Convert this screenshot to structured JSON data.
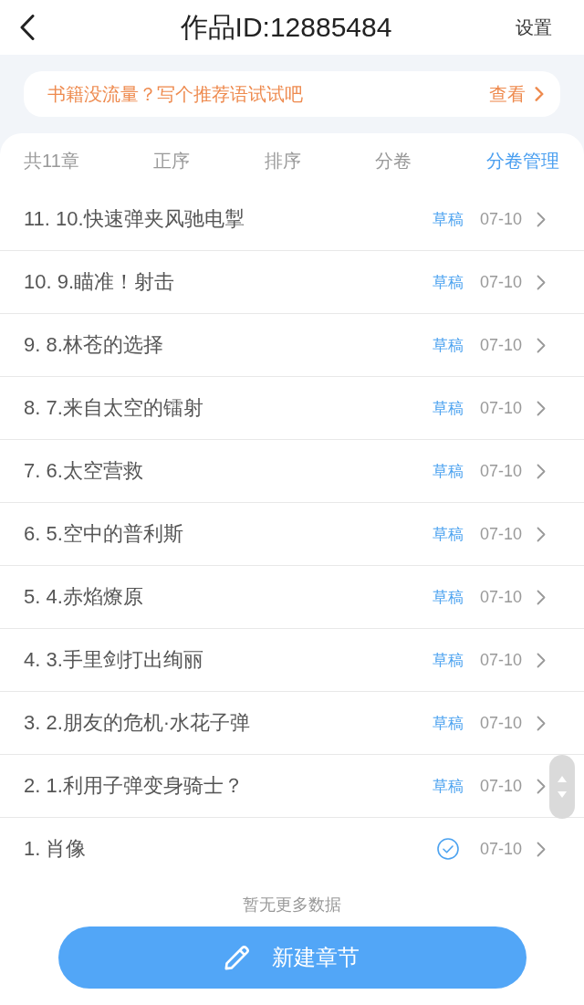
{
  "header": {
    "title": "作品ID:12885484",
    "action": "设置"
  },
  "banner": {
    "text": "书籍没流量？写个推荐语试试吧",
    "link": "查看"
  },
  "toolbar": {
    "count": "共11章",
    "actions": [
      {
        "label": "正序",
        "selected": false
      },
      {
        "label": "排序",
        "selected": false
      },
      {
        "label": "分卷",
        "selected": false
      },
      {
        "label": "分卷管理",
        "selected": true
      }
    ]
  },
  "chapters": [
    {
      "title": "11. 10.快速弹夹风驰电掣",
      "status": {
        "kind": "draft",
        "label": "草稿"
      },
      "date": "07-10"
    },
    {
      "title": "10. 9.瞄准！射击",
      "status": {
        "kind": "draft",
        "label": "草稿"
      },
      "date": "07-10"
    },
    {
      "title": "9. 8.林苍的选择",
      "status": {
        "kind": "draft",
        "label": "草稿"
      },
      "date": "07-10"
    },
    {
      "title": "8. 7.来自太空的镭射",
      "status": {
        "kind": "draft",
        "label": "草稿"
      },
      "date": "07-10"
    },
    {
      "title": "7. 6.太空营救",
      "status": {
        "kind": "draft",
        "label": "草稿"
      },
      "date": "07-10"
    },
    {
      "title": "6. 5.空中的普利斯",
      "status": {
        "kind": "draft",
        "label": "草稿"
      },
      "date": "07-10"
    },
    {
      "title": "5. 4.赤焰燎原",
      "status": {
        "kind": "draft",
        "label": "草稿"
      },
      "date": "07-10"
    },
    {
      "title": "4. 3.手里剑打出绚丽",
      "status": {
        "kind": "draft",
        "label": "草稿"
      },
      "date": "07-10"
    },
    {
      "title": "3. 2.朋友的危机·水花子弹",
      "status": {
        "kind": "draft",
        "label": "草稿"
      },
      "date": "07-10"
    },
    {
      "title": "2. 1.利用子弹变身骑士？",
      "status": {
        "kind": "draft",
        "label": "草稿"
      },
      "date": "07-10"
    },
    {
      "title": "1. 肖像",
      "status": {
        "kind": "published"
      },
      "date": "07-10"
    }
  ],
  "end_text": "暂无更多数据",
  "button": {
    "label": "新建章节"
  }
}
